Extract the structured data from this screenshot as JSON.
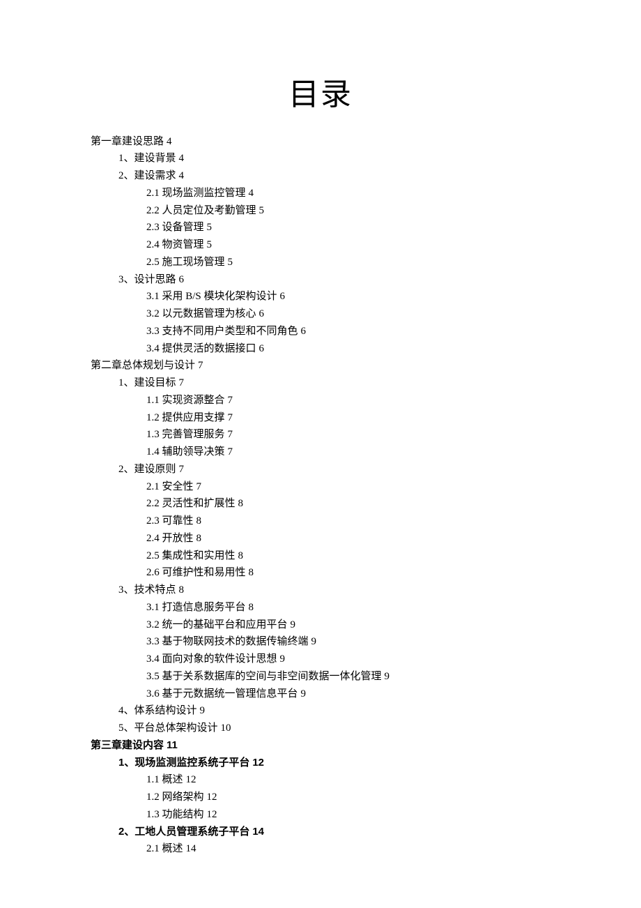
{
  "title": "目录",
  "toc": [
    {
      "level": 1,
      "text": "第一章建设思路",
      "page": "4",
      "bold": false
    },
    {
      "level": 2,
      "text": "1、建设背景",
      "page": "4",
      "bold": false
    },
    {
      "level": 2,
      "text": "2、建设需求",
      "page": "4",
      "bold": false
    },
    {
      "level": 3,
      "text": "2.1 现场监测监控管理",
      "page": "4",
      "bold": false
    },
    {
      "level": 3,
      "text": "2.2 人员定位及考勤管理",
      "page": "5",
      "bold": false
    },
    {
      "level": 3,
      "text": "2.3 设备管理",
      "page": "5",
      "bold": false
    },
    {
      "level": 3,
      "text": "2.4 物资管理",
      "page": "5",
      "bold": false
    },
    {
      "level": 3,
      "text": "2.5 施工现场管理",
      "page": "5",
      "bold": false
    },
    {
      "level": 2,
      "text": "3、设计思路",
      "page": "6",
      "bold": false
    },
    {
      "level": 3,
      "text": "3.1 采用 B/S 模块化架构设计",
      "page": "6",
      "bold": false
    },
    {
      "level": 3,
      "text": "3.2 以元数据管理为核心",
      "page": "6",
      "bold": false
    },
    {
      "level": 3,
      "text": "3.3 支持不同用户类型和不同角色",
      "page": "6",
      "bold": false
    },
    {
      "level": 3,
      "text": "3.4 提供灵活的数据接口",
      "page": "6",
      "bold": false
    },
    {
      "level": 1,
      "text": "第二章总体规划与设计",
      "page": "7",
      "bold": false
    },
    {
      "level": 2,
      "text": "1、建设目标",
      "page": "7",
      "bold": false
    },
    {
      "level": 3,
      "text": "1.1 实现资源整合",
      "page": "7",
      "bold": false
    },
    {
      "level": 3,
      "text": "1.2 提供应用支撑",
      "page": "7",
      "bold": false
    },
    {
      "level": 3,
      "text": "1.3 完善管理服务",
      "page": "7",
      "bold": false
    },
    {
      "level": 3,
      "text": "1.4 辅助领导决策",
      "page": "7",
      "bold": false
    },
    {
      "level": 2,
      "text": "2、建设原则",
      "page": "7",
      "bold": false
    },
    {
      "level": 3,
      "text": "2.1 安全性",
      "page": "7",
      "bold": false
    },
    {
      "level": 3,
      "text": "2.2 灵活性和扩展性",
      "page": "8",
      "bold": false
    },
    {
      "level": 3,
      "text": "2.3 可靠性",
      "page": "8",
      "bold": false
    },
    {
      "level": 3,
      "text": "2.4 开放性",
      "page": "8",
      "bold": false
    },
    {
      "level": 3,
      "text": "2.5 集成性和实用性",
      "page": "8",
      "bold": false
    },
    {
      "level": 3,
      "text": "2.6 可维护性和易用性",
      "page": "8",
      "bold": false
    },
    {
      "level": 2,
      "text": "3、技术特点",
      "page": "8",
      "bold": false
    },
    {
      "level": 3,
      "text": "3.1 打造信息服务平台",
      "page": "8",
      "bold": false
    },
    {
      "level": 3,
      "text": "3.2 统一的基础平台和应用平台",
      "page": "9",
      "bold": false
    },
    {
      "level": 3,
      "text": "3.3 基于物联网技术的数据传输终端",
      "page": "9",
      "bold": false
    },
    {
      "level": 3,
      "text": "3.4 面向对象的软件设计思想",
      "page": "9",
      "bold": false
    },
    {
      "level": 3,
      "text": "3.5 基于关系数据库的空间与非空间数据一体化管理",
      "page": "9",
      "bold": false
    },
    {
      "level": 3,
      "text": "3.6 基于元数据统一管理信息平台",
      "page": "9",
      "bold": false
    },
    {
      "level": 2,
      "text": "4、体系结构设计",
      "page": "9",
      "bold": false
    },
    {
      "level": 2,
      "text": "5、平台总体架构设计",
      "page": "10",
      "bold": false
    },
    {
      "level": 1,
      "text": "第三章建设内容",
      "page": "11",
      "bold": true
    },
    {
      "level": 2,
      "text": "1、现场监测监控系统子平台",
      "page": "12",
      "bold": true
    },
    {
      "level": 3,
      "text": "1.1 概述",
      "page": "12",
      "bold": false
    },
    {
      "level": 3,
      "text": "1.2 网络架构",
      "page": "12",
      "bold": false
    },
    {
      "level": 3,
      "text": "1.3 功能结构",
      "page": "12",
      "bold": false
    },
    {
      "level": 2,
      "text": "2、工地人员管理系统子平台",
      "page": "14",
      "bold": true
    },
    {
      "level": 3,
      "text": "2.1 概述",
      "page": "14",
      "bold": false
    }
  ]
}
